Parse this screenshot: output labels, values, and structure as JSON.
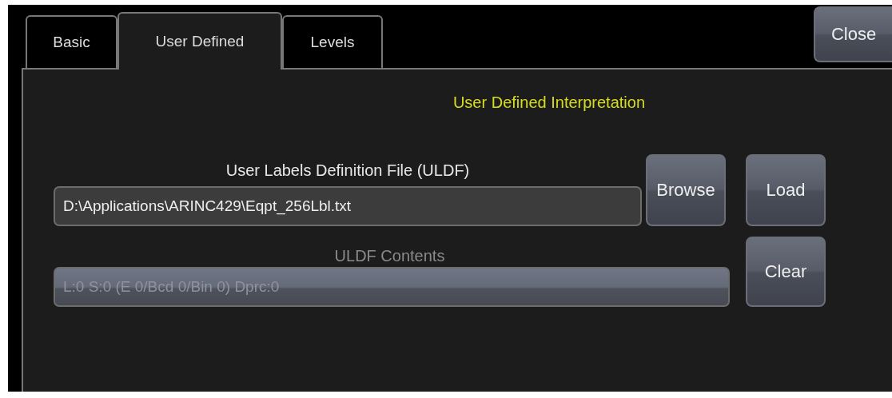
{
  "tabs": [
    {
      "label": "Basic",
      "selected": false
    },
    {
      "label": "User Defined",
      "selected": true
    },
    {
      "label": "Levels",
      "selected": false
    }
  ],
  "close_button": "Close",
  "panel": {
    "title": "User Defined Interpretation",
    "file_label": "User Labels Definition File (ULDF)",
    "file_field": {
      "value": "D:\\Applications\\ARINC429\\Eqpt_256Lbl.txt",
      "disabled": false
    },
    "browse_button": "Browse",
    "load_button": "Load",
    "contents_label": "ULDF Contents",
    "contents_field": {
      "value": "L:0 S:0 (E 0/Bcd 0/Bin 0) Dprc:0",
      "disabled": true
    },
    "clear_button": "Clear"
  }
}
